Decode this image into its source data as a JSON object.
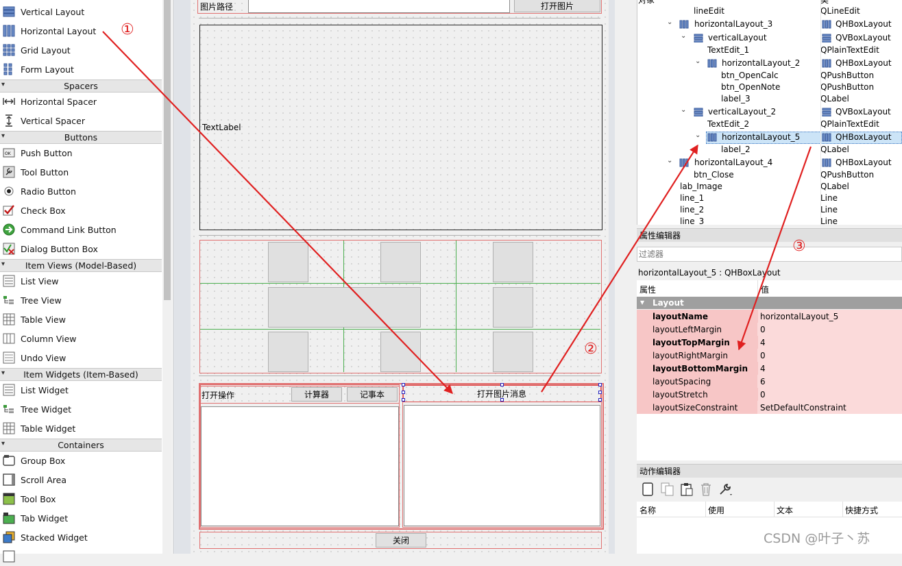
{
  "widget_box": {
    "layouts": [
      {
        "label": "Vertical Layout",
        "icon": "vertical-layout-icon"
      },
      {
        "label": "Horizontal Layout",
        "icon": "horizontal-layout-icon"
      },
      {
        "label": "Grid Layout",
        "icon": "grid-layout-icon"
      },
      {
        "label": "Form Layout",
        "icon": "form-layout-icon"
      }
    ],
    "categories": {
      "spacers": "Spacers",
      "buttons": "Buttons",
      "item_views": "Item Views (Model-Based)",
      "item_widgets": "Item Widgets (Item-Based)",
      "containers": "Containers"
    },
    "spacers": [
      {
        "label": "Horizontal Spacer",
        "icon": "horizontal-spacer-icon"
      },
      {
        "label": "Vertical Spacer",
        "icon": "vertical-spacer-icon"
      }
    ],
    "buttons": [
      {
        "label": "Push Button",
        "icon": "push-button-icon"
      },
      {
        "label": "Tool Button",
        "icon": "tool-button-icon"
      },
      {
        "label": "Radio Button",
        "icon": "radio-button-icon"
      },
      {
        "label": "Check Box",
        "icon": "check-box-icon"
      },
      {
        "label": "Command Link Button",
        "icon": "command-link-icon"
      },
      {
        "label": "Dialog Button Box",
        "icon": "dialog-button-box-icon"
      }
    ],
    "item_views": [
      {
        "label": "List View",
        "icon": "list-view-icon"
      },
      {
        "label": "Tree View",
        "icon": "tree-view-icon"
      },
      {
        "label": "Table View",
        "icon": "table-view-icon"
      },
      {
        "label": "Column View",
        "icon": "column-view-icon"
      },
      {
        "label": "Undo View",
        "icon": "undo-view-icon"
      }
    ],
    "item_widgets": [
      {
        "label": "List Widget",
        "icon": "list-widget-icon"
      },
      {
        "label": "Tree Widget",
        "icon": "tree-widget-icon"
      },
      {
        "label": "Table Widget",
        "icon": "table-widget-icon"
      }
    ],
    "containers": [
      {
        "label": "Group Box",
        "icon": "group-box-icon"
      },
      {
        "label": "Scroll Area",
        "icon": "scroll-area-icon"
      },
      {
        "label": "Tool Box",
        "icon": "tool-box-icon"
      },
      {
        "label": "Tab Widget",
        "icon": "tab-widget-icon"
      },
      {
        "label": "Stacked Widget",
        "icon": "stacked-widget-icon"
      }
    ]
  },
  "form": {
    "path_label": "图片路径",
    "open_image_button": "打开图片",
    "text_label": "TextLabel",
    "open_ops_label": "打开操作",
    "calculator_button": "计算器",
    "notepad_button": "记事本",
    "open_image_msg": "打开图片消息",
    "close_button": "关闭"
  },
  "annotations": {
    "marker_1": "①",
    "marker_2": "②",
    "marker_3": "③",
    "arrow_color": "#e02020"
  },
  "object_inspector": {
    "header_partial_left": "对象",
    "header_partial_right": "类",
    "rows": [
      {
        "name": "lineEdit",
        "cls": "QLineEdit"
      },
      {
        "name": "horizontalLayout_3",
        "cls": "QHBoxLayout"
      },
      {
        "name": "verticalLayout",
        "cls": "QVBoxLayout"
      },
      {
        "name": "TextEdit_1",
        "cls": "QPlainTextEdit"
      },
      {
        "name": "horizontalLayout_2",
        "cls": "QHBoxLayout"
      },
      {
        "name": "btn_OpenCalc",
        "cls": "QPushButton"
      },
      {
        "name": "btn_OpenNote",
        "cls": "QPushButton"
      },
      {
        "name": "label_3",
        "cls": "QLabel"
      },
      {
        "name": "verticalLayout_2",
        "cls": "QVBoxLayout"
      },
      {
        "name": "TextEdit_2",
        "cls": "QPlainTextEdit"
      },
      {
        "name": "horizontalLayout_5",
        "cls": "QHBoxLayout"
      },
      {
        "name": "label_2",
        "cls": "QLabel"
      },
      {
        "name": "horizontalLayout_4",
        "cls": "QHBoxLayout"
      },
      {
        "name": "btn_Close",
        "cls": "QPushButton"
      },
      {
        "name": "lab_Image",
        "cls": "QLabel"
      },
      {
        "name": "line_1",
        "cls": "Line"
      },
      {
        "name": "line_2",
        "cls": "Line"
      },
      {
        "name": "line_3",
        "cls": "Line"
      }
    ]
  },
  "property_editor": {
    "title": "属性编辑器",
    "filter_placeholder": "过滤器",
    "object_line": "horizontalLayout_5 : QHBoxLayout",
    "col_property": "属性",
    "col_value": "值",
    "group": "Layout",
    "props": [
      {
        "k": "layoutName",
        "v": "horizontalLayout_5"
      },
      {
        "k": "layoutLeftMargin",
        "v": "0"
      },
      {
        "k": "layoutTopMargin",
        "v": "4"
      },
      {
        "k": "layoutRightMargin",
        "v": "0"
      },
      {
        "k": "layoutBottomMargin",
        "v": "4"
      },
      {
        "k": "layoutSpacing",
        "v": "6"
      },
      {
        "k": "layoutStretch",
        "v": "0"
      },
      {
        "k": "layoutSizeConstraint",
        "v": "SetDefaultConstraint"
      }
    ]
  },
  "action_editor": {
    "title": "动作编辑器",
    "columns": [
      "名称",
      "使用",
      "文本",
      "快捷方式"
    ]
  },
  "watermark": "CSDN @叶子丶苏"
}
